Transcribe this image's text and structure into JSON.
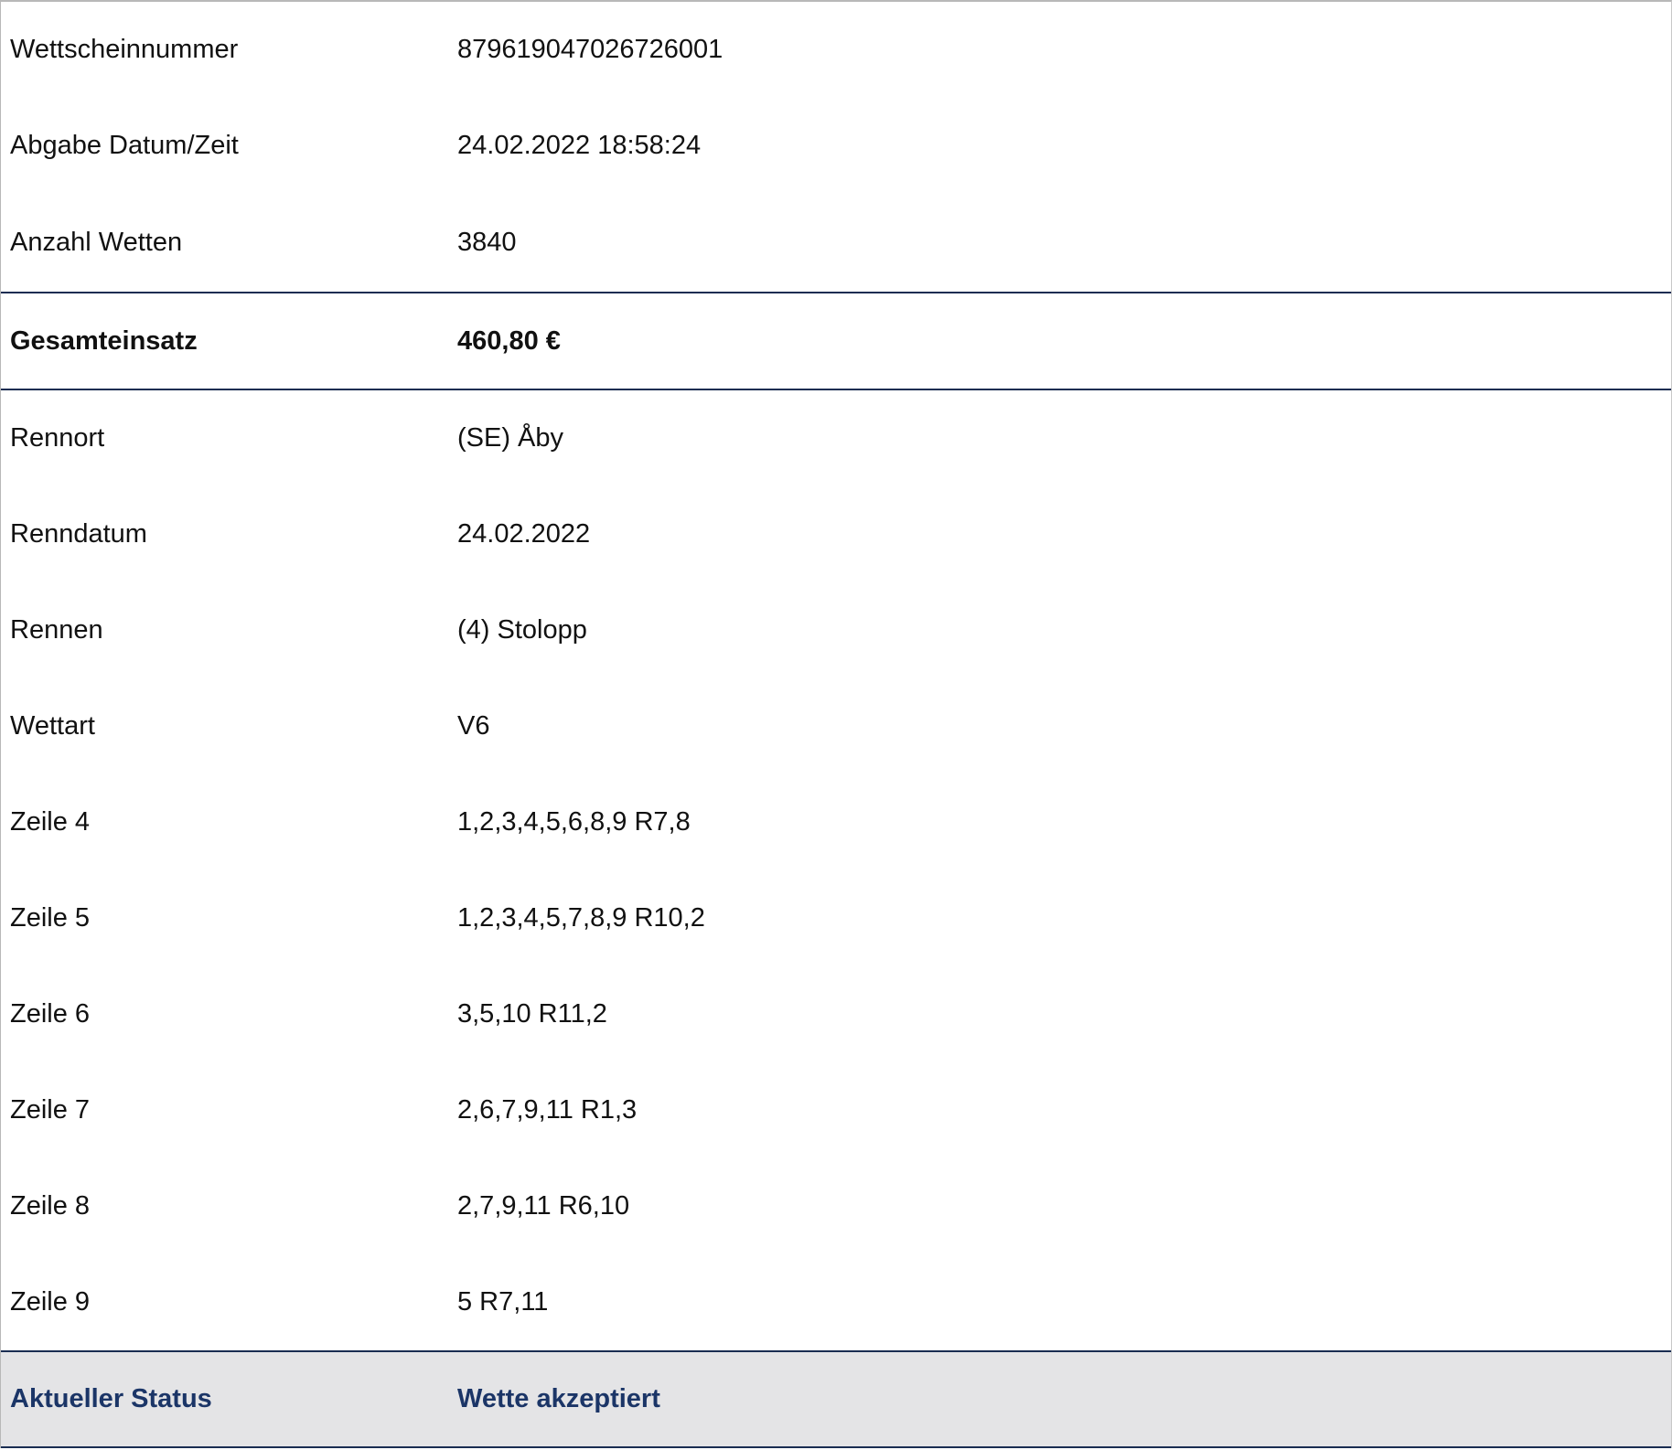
{
  "top_rows": [
    {
      "label": "Wettscheinnummer",
      "value": "879619047026726001"
    },
    {
      "label": "Abgabe Datum/Zeit",
      "value": "24.02.2022 18:58:24"
    },
    {
      "label": "Anzahl Wetten",
      "value": "3840"
    }
  ],
  "total": {
    "label": "Gesamteinsatz",
    "value": "460,80 €"
  },
  "race_rows": [
    {
      "label": "Rennort",
      "value": "(SE) Åby"
    },
    {
      "label": "Renndatum",
      "value": "24.02.2022"
    },
    {
      "label": "Rennen",
      "value": "(4) Stolopp"
    },
    {
      "label": "Wettart",
      "value": "V6"
    },
    {
      "label": "Zeile 4",
      "value": "1,2,3,4,5,6,8,9 R7,8"
    },
    {
      "label": "Zeile 5",
      "value": "1,2,3,4,5,7,8,9 R10,2"
    },
    {
      "label": "Zeile 6",
      "value": "3,5,10 R11,2"
    },
    {
      "label": "Zeile 7",
      "value": "2,6,7,9,11 R1,3"
    },
    {
      "label": "Zeile 8",
      "value": "2,7,9,11 R6,10"
    },
    {
      "label": "Zeile 9",
      "value": "5 R7,11"
    }
  ],
  "status": {
    "label": "Aktueller Status",
    "value": "Wette akzeptiert"
  },
  "colors": {
    "status_text": "#1b3567",
    "status_bg": "#e4e4e6",
    "separator": "#1a2d52"
  }
}
